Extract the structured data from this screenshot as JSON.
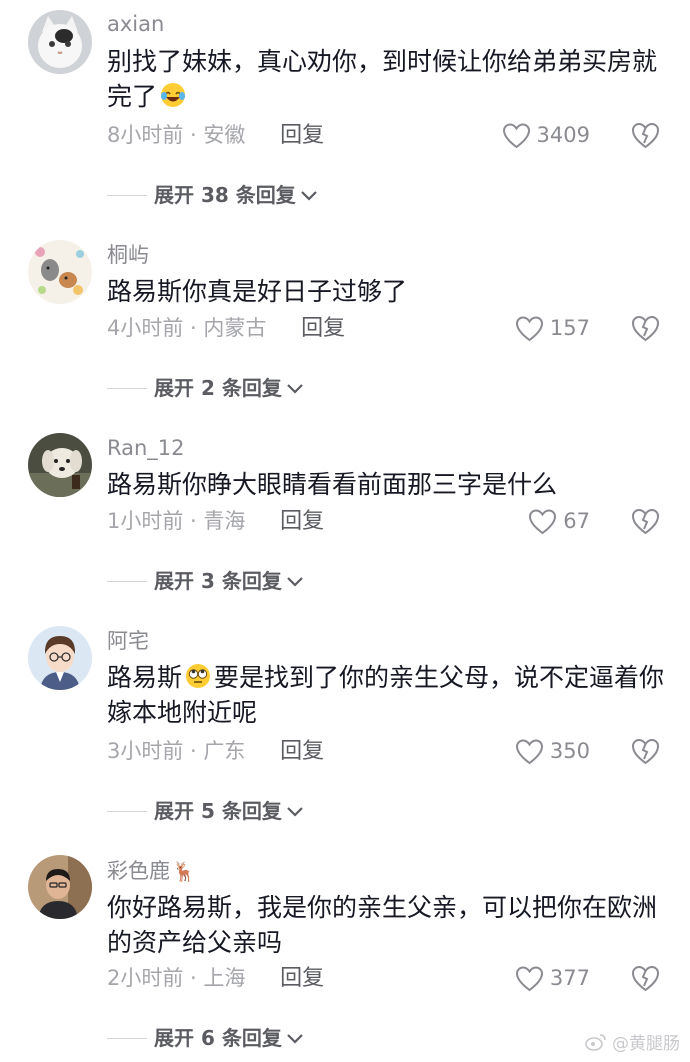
{
  "comments": [
    {
      "username": "axian",
      "text": "别找了妹妹，真心劝你，到时候让你给弟弟买房就完了",
      "emoji": "laughing-tears",
      "time_loc": "8小时前 · 安徽",
      "reply_label": "回复",
      "likes": "3409",
      "expand_label": "展开 38 条回复"
    },
    {
      "username": "桐屿",
      "text": "路易斯你真是好日子过够了",
      "time_loc": "4小时前 · 内蒙古",
      "reply_label": "回复",
      "likes": "157",
      "expand_label": "展开 2 条回复"
    },
    {
      "username": "Ran_12",
      "text": "路易斯你睁大眼睛看看前面那三字是什么",
      "time_loc": "1小时前 · 青海",
      "reply_label": "回复",
      "likes": "67",
      "expand_label": "展开 3 条回复"
    },
    {
      "username": "阿宅",
      "text_before_emoji": "路易斯",
      "emoji": "eye-roll",
      "text_after_emoji": "要是找到了你的亲生父母，说不定逼着你嫁本地附近呢",
      "time_loc": "3小时前 · 广东",
      "reply_label": "回复",
      "likes": "350",
      "expand_label": "展开 5 条回复"
    },
    {
      "username": "彩色鹿",
      "username_emoji": "🦌",
      "text": "你好路易斯，我是你的亲生父亲，可以把你在欧洲的资产给父亲吗",
      "time_loc": "2小时前 · 上海",
      "reply_label": "回复",
      "likes": "377",
      "expand_label": "展开 6 条回复"
    }
  ],
  "watermark": "@黄腿肠",
  "colors": {
    "background": "#ffffff",
    "text": "#161823",
    "muted": "#8a8b91",
    "meta": "#a5a6ab"
  }
}
